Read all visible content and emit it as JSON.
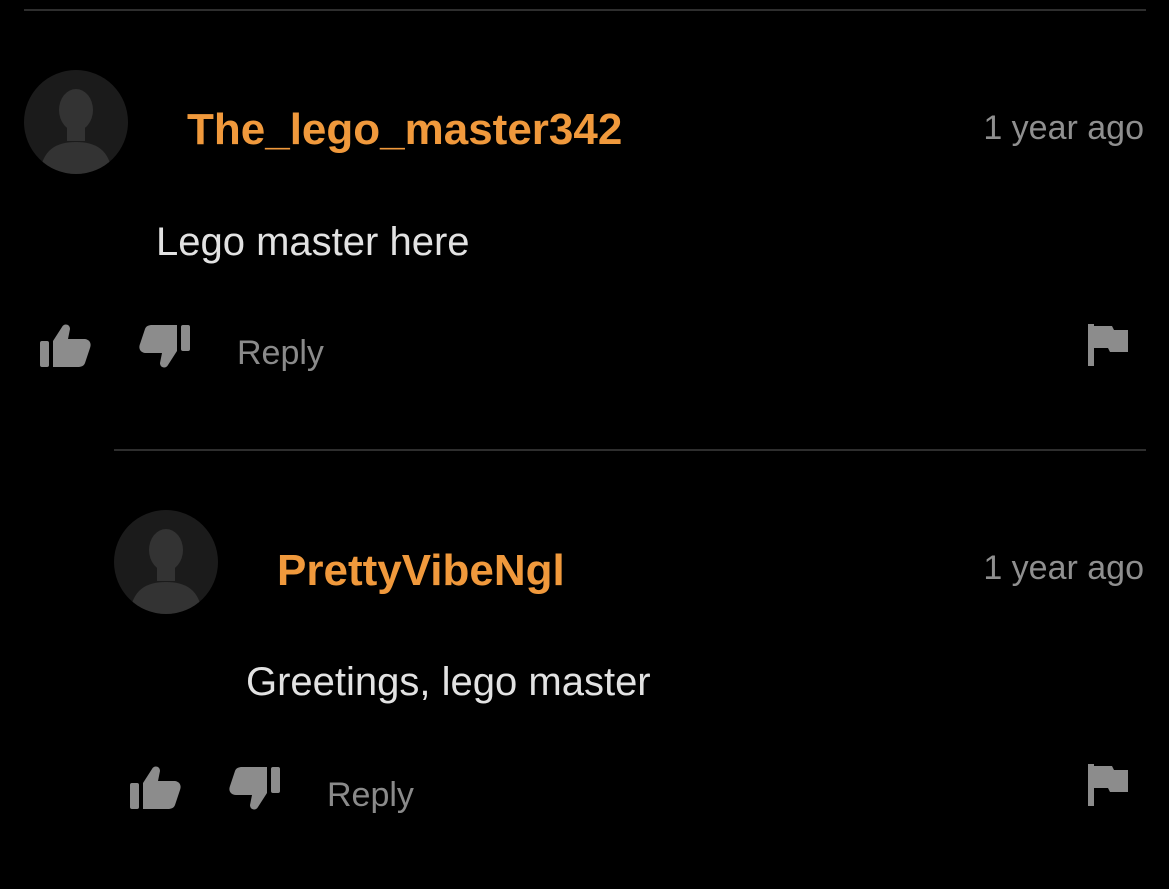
{
  "comments": [
    {
      "username": "The_lego_master342",
      "timestamp": "1 year ago",
      "text": "Lego master here",
      "reply_label": "Reply"
    },
    {
      "username": "PrettyVibeNgl",
      "timestamp": "1 year ago",
      "text": "Greetings, lego master",
      "reply_label": "Reply"
    }
  ],
  "colors": {
    "background": "#000000",
    "username": "#f0993c",
    "body_text": "#e2e2e2",
    "muted_text": "#8f8f8f",
    "icon": "#8c8c8c",
    "avatar_bg": "#1b1b1b",
    "avatar_silhouette": "#333333",
    "divider": "#2e2e2e"
  },
  "icons": {
    "avatar": "default-user-icon",
    "like": "thumbs-up-icon",
    "dislike": "thumbs-down-icon",
    "report": "flag-icon"
  }
}
